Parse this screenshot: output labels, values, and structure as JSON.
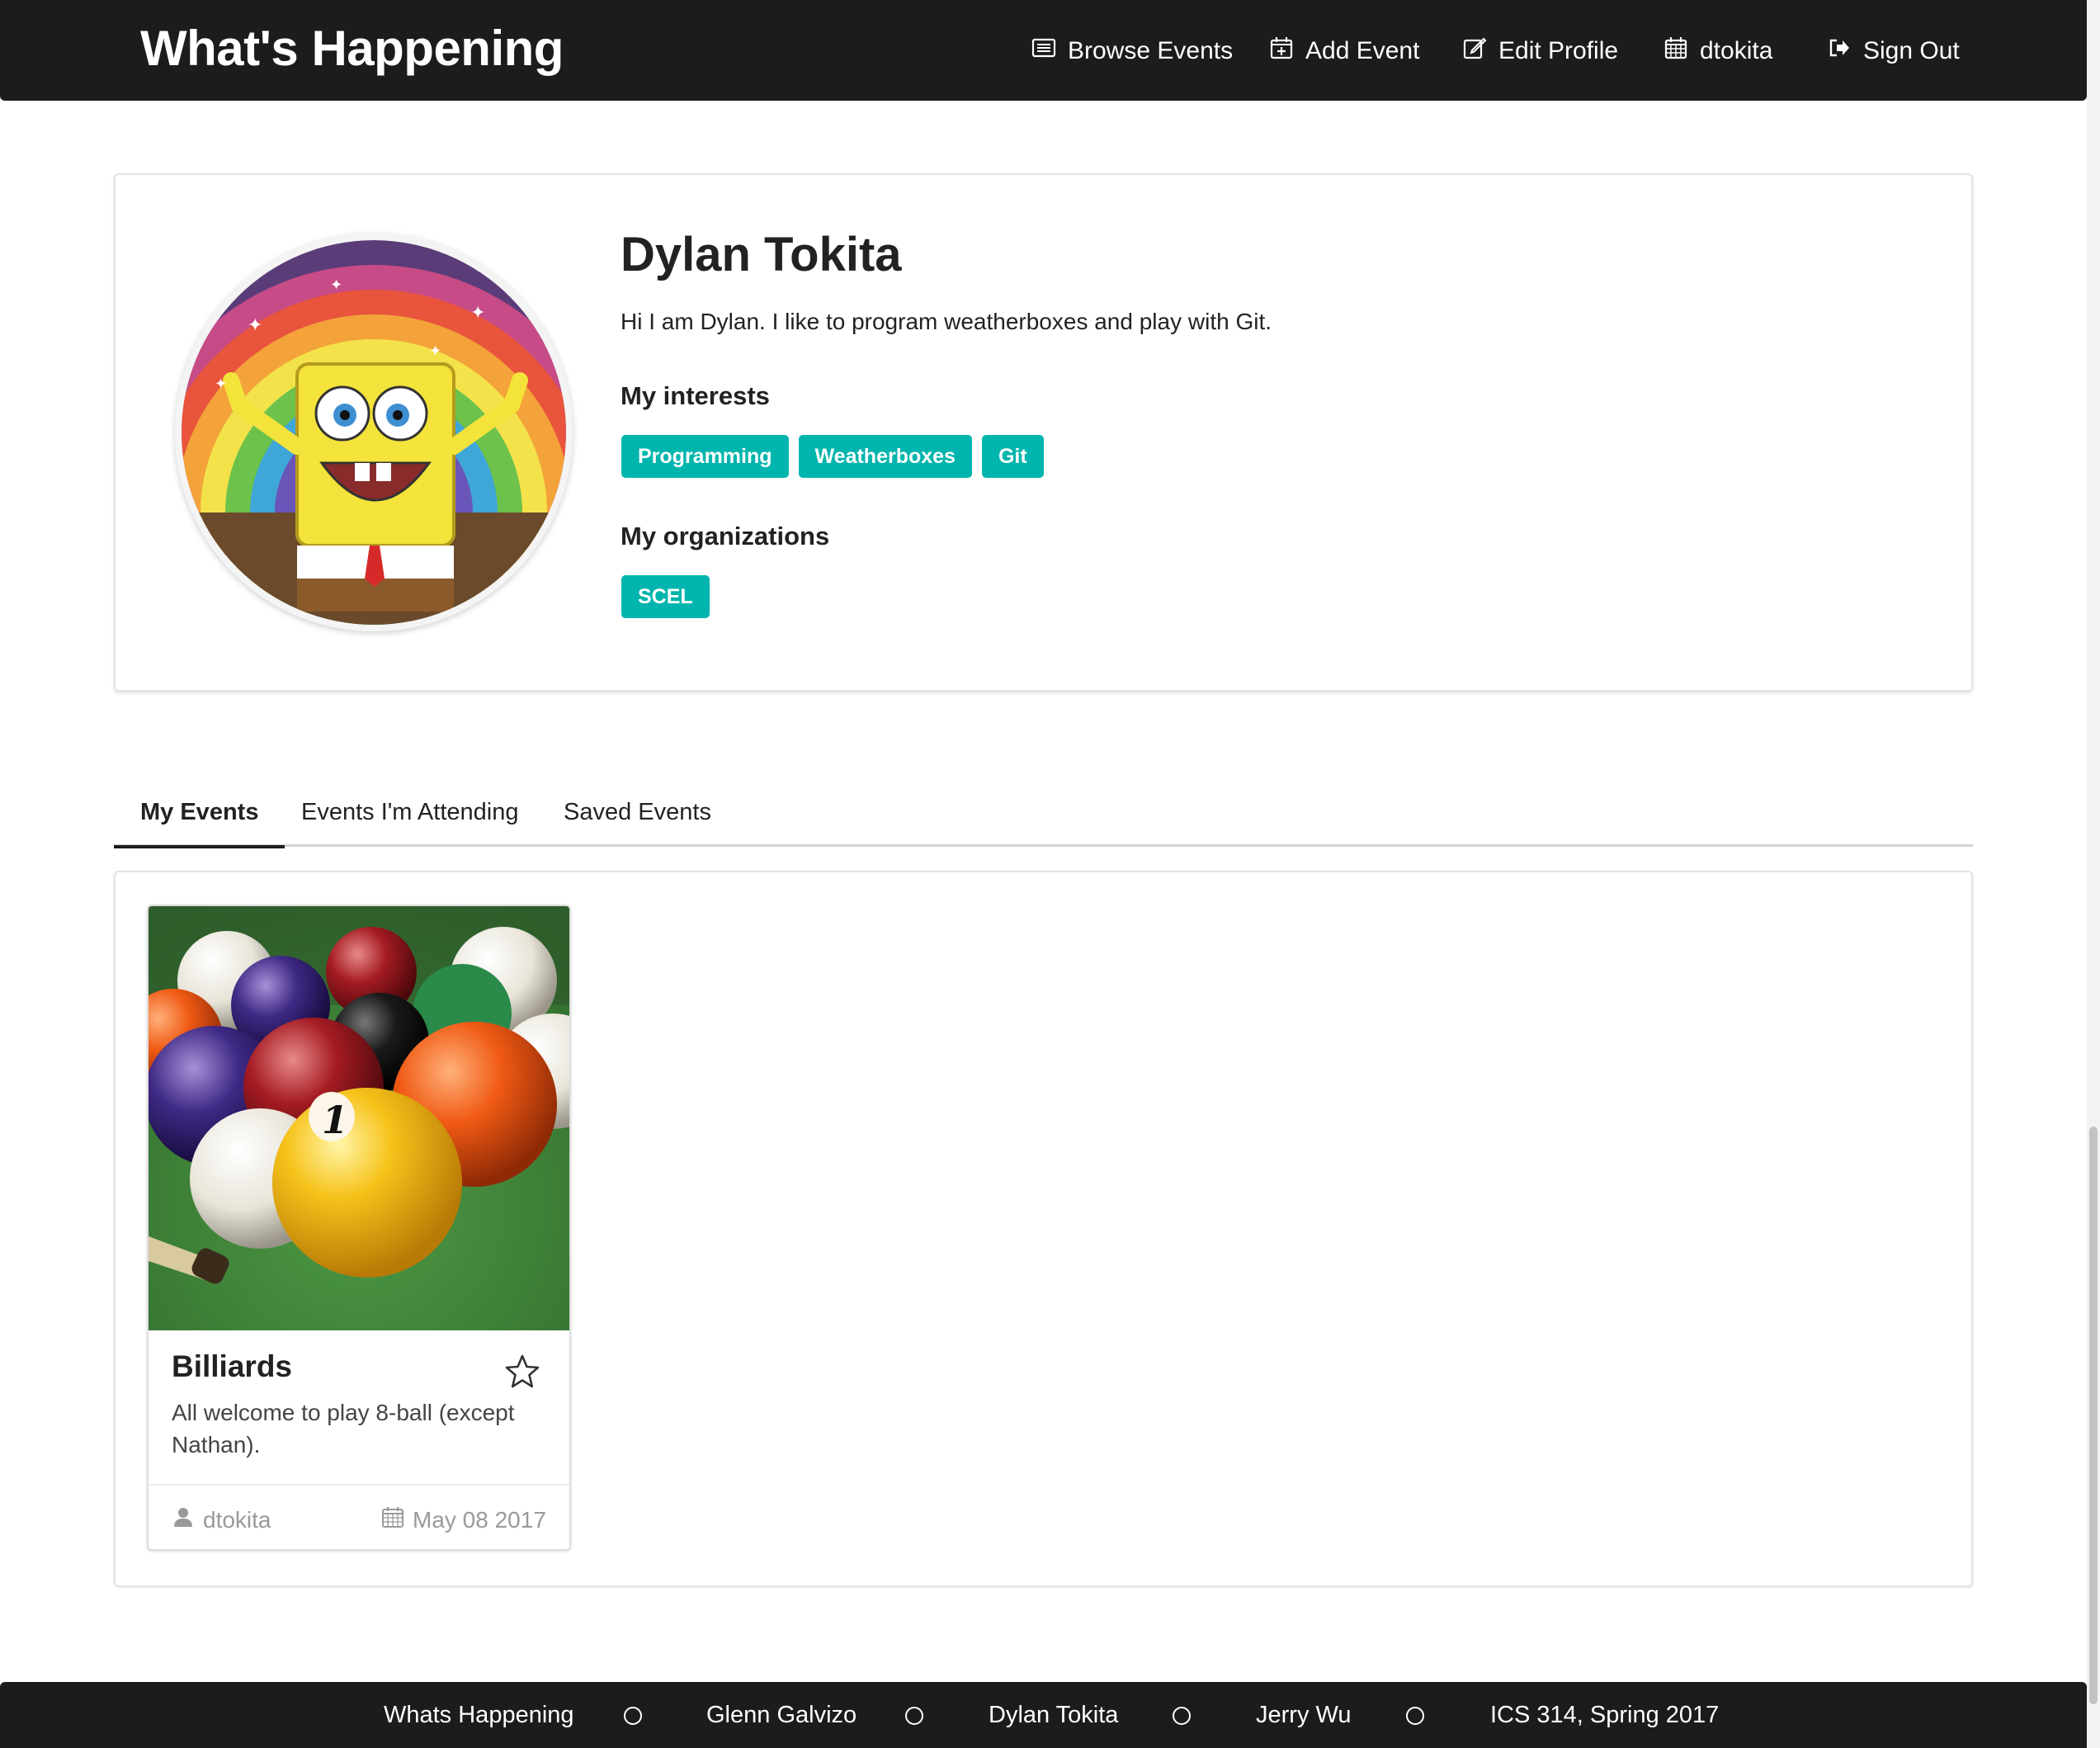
{
  "navbar": {
    "brand": "What's Happening",
    "items": [
      {
        "label": "Browse Events",
        "icon": "list-icon"
      },
      {
        "label": "Add Event",
        "icon": "calendar-plus-icon"
      },
      {
        "label": "Edit Profile",
        "icon": "edit-icon"
      },
      {
        "label": "dtokita",
        "icon": "calendar-icon"
      },
      {
        "label": "Sign Out",
        "icon": "sign-out-icon"
      }
    ]
  },
  "profile": {
    "name": "Dylan Tokita",
    "bio": "Hi I am Dylan. I like to program weatherboxes and play with Git.",
    "interests_title": "My interests",
    "interests": [
      "Programming",
      "Weatherboxes",
      "Git"
    ],
    "organizations_title": "My organizations",
    "organizations": [
      "SCEL"
    ]
  },
  "tabs": [
    {
      "label": "My Events",
      "active": true
    },
    {
      "label": "Events I'm Attending",
      "active": false
    },
    {
      "label": "Saved Events",
      "active": false
    }
  ],
  "events": [
    {
      "title": "Billiards",
      "description": "All welcome to play 8-ball (except Nathan).",
      "owner": "dtokita",
      "date": "May 08 2017"
    }
  ],
  "footer": {
    "items": [
      "Whats Happening",
      "Glenn Galvizo",
      "Dylan Tokita",
      "Jerry Wu",
      "ICS 314, Spring 2017"
    ]
  },
  "colors": {
    "navbar_bg": "#1b1c1d",
    "tag_teal": "#00b5ad",
    "text": "#222222",
    "meta_gray": "#9a9a9a"
  }
}
